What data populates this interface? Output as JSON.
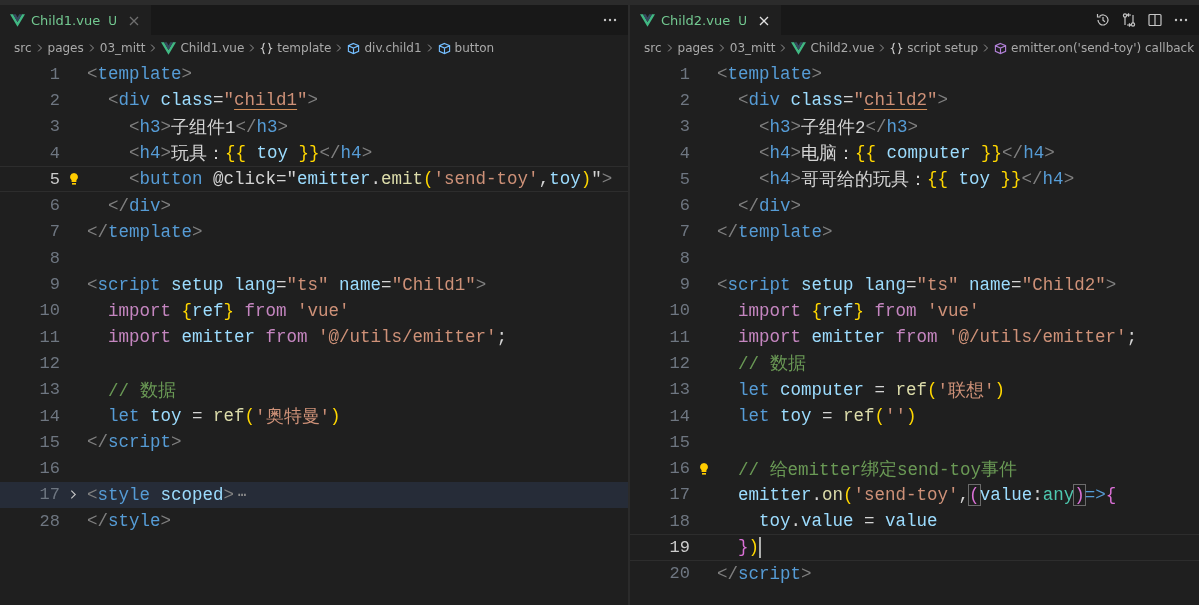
{
  "editors": [
    {
      "tab": {
        "label": "Child1.vue",
        "status": "U",
        "selected": true
      },
      "actions": [
        {
          "kind": "more"
        }
      ],
      "breadcrumbs": [
        {
          "label": "src",
          "kind": "folder"
        },
        {
          "label": "pages",
          "kind": "folder"
        },
        {
          "label": "03_mitt",
          "kind": "folder"
        },
        {
          "label": "Child1.vue",
          "kind": "vue"
        },
        {
          "label": "template",
          "kind": "braces"
        },
        {
          "label": "div.child1",
          "kind": "element"
        },
        {
          "label": "button",
          "kind": "element"
        }
      ],
      "lines": [
        {
          "number": "1",
          "tokens": [
            {
              "text": "<",
              "kind": "p"
            },
            {
              "text": "template",
              "kind": "tag"
            },
            {
              "text": ">",
              "kind": "p"
            }
          ]
        },
        {
          "number": "2",
          "tokens": [
            {
              "text": "  <",
              "kind": "p"
            },
            {
              "text": "div",
              "kind": "tag"
            },
            {
              "text": " class",
              "kind": "attr"
            },
            {
              "text": "=",
              "kind": "text"
            },
            {
              "text": "\"",
              "kind": "string"
            },
            {
              "text": "child1",
              "kind": "classname"
            },
            {
              "text": "\"",
              "kind": "string"
            },
            {
              "text": ">",
              "kind": "p"
            }
          ]
        },
        {
          "number": "3",
          "tokens": [
            {
              "text": "    <",
              "kind": "p"
            },
            {
              "text": "h3",
              "kind": "tag"
            },
            {
              "text": ">",
              "kind": "p"
            },
            {
              "text": "子组件1",
              "kind": "text"
            },
            {
              "text": "</",
              "kind": "p"
            },
            {
              "text": "h3",
              "kind": "tag"
            },
            {
              "text": ">",
              "kind": "p"
            }
          ]
        },
        {
          "number": "4",
          "tokens": [
            {
              "text": "    <",
              "kind": "p"
            },
            {
              "text": "h4",
              "kind": "tag"
            },
            {
              "text": ">",
              "kind": "p"
            },
            {
              "text": "玩具：",
              "kind": "text"
            },
            {
              "text": "{{",
              "kind": "brace"
            },
            {
              "text": " toy ",
              "kind": "var"
            },
            {
              "text": "}}",
              "kind": "brace"
            },
            {
              "text": "</",
              "kind": "p"
            },
            {
              "text": "h4",
              "kind": "tag"
            },
            {
              "text": ">",
              "kind": "p"
            }
          ]
        },
        {
          "number": "5",
          "current": true,
          "bulb": true,
          "tokens": [
            {
              "text": "    <",
              "kind": "p"
            },
            {
              "text": "button",
              "kind": "tag"
            },
            {
              "text": " @click=\"",
              "kind": "text"
            },
            {
              "text": "emitter",
              "kind": "var"
            },
            {
              "text": ".",
              "kind": "text"
            },
            {
              "text": "emit",
              "kind": "func"
            },
            {
              "text": "(",
              "kind": "brace"
            },
            {
              "text": "'send-toy'",
              "kind": "string"
            },
            {
              "text": ",",
              "kind": "text"
            },
            {
              "text": "toy",
              "kind": "var"
            },
            {
              "text": ")",
              "kind": "brace"
            },
            {
              "text": "\"",
              "kind": "text"
            },
            {
              "text": ">",
              "kind": "p"
            }
          ]
        },
        {
          "number": "6",
          "tokens": [
            {
              "text": "  </",
              "kind": "p"
            },
            {
              "text": "div",
              "kind": "tag"
            },
            {
              "text": ">",
              "kind": "p"
            }
          ]
        },
        {
          "number": "7",
          "tokens": [
            {
              "text": "</",
              "kind": "p"
            },
            {
              "text": "template",
              "kind": "tag"
            },
            {
              "text": ">",
              "kind": "p"
            }
          ]
        },
        {
          "number": "8"
        },
        {
          "number": "9",
          "tokens": [
            {
              "text": "<",
              "kind": "p"
            },
            {
              "text": "script",
              "kind": "tag"
            },
            {
              "text": " setup lang",
              "kind": "attr"
            },
            {
              "text": "=",
              "kind": "text"
            },
            {
              "text": "\"ts\"",
              "kind": "string"
            },
            {
              "text": " name",
              "kind": "attr"
            },
            {
              "text": "=",
              "kind": "text"
            },
            {
              "text": "\"Child1\"",
              "kind": "string"
            },
            {
              "text": ">",
              "kind": "p"
            }
          ]
        },
        {
          "number": "10",
          "tokens": [
            {
              "text": "  import",
              "kind": "keyword"
            },
            {
              "text": " {",
              "kind": "brace"
            },
            {
              "text": "ref",
              "kind": "var"
            },
            {
              "text": "}",
              "kind": "brace"
            },
            {
              "text": " from",
              "kind": "keyword"
            },
            {
              "text": " 'vue'",
              "kind": "string"
            }
          ]
        },
        {
          "number": "11",
          "tokens": [
            {
              "text": "  import",
              "kind": "keyword"
            },
            {
              "text": " emitter",
              "kind": "var"
            },
            {
              "text": " from",
              "kind": "keyword"
            },
            {
              "text": " '@/utils/emitter'",
              "kind": "string"
            },
            {
              "text": ";",
              "kind": "text"
            }
          ]
        },
        {
          "number": "12"
        },
        {
          "number": "13",
          "tokens": [
            {
              "text": "  // 数据",
              "kind": "comment"
            }
          ]
        },
        {
          "number": "14",
          "tokens": [
            {
              "text": "  let",
              "kind": "tag"
            },
            {
              "text": " toy",
              "kind": "var"
            },
            {
              "text": " = ",
              "kind": "text"
            },
            {
              "text": "ref",
              "kind": "func"
            },
            {
              "text": "(",
              "kind": "brace"
            },
            {
              "text": "'奥特曼'",
              "kind": "string"
            },
            {
              "text": ")",
              "kind": "brace"
            }
          ]
        },
        {
          "number": "15",
          "tokens": [
            {
              "text": "</",
              "kind": "p"
            },
            {
              "text": "script",
              "kind": "tag"
            },
            {
              "text": ">",
              "kind": "p"
            }
          ]
        },
        {
          "number": "16"
        },
        {
          "number": "17",
          "folded": true,
          "tokens": [
            {
              "text": "<",
              "kind": "p"
            },
            {
              "text": "style",
              "kind": "tag"
            },
            {
              "text": " scoped",
              "kind": "attr"
            },
            {
              "text": ">",
              "kind": "p"
            },
            {
              "text": "⋯",
              "kind": "ellipsis"
            }
          ]
        },
        {
          "number": "28",
          "tokens": [
            {
              "text": "</",
              "kind": "p"
            },
            {
              "text": "style",
              "kind": "tag"
            },
            {
              "text": ">",
              "kind": "p"
            }
          ]
        }
      ]
    },
    {
      "tab": {
        "label": "Child2.vue",
        "status": "U",
        "selected": true
      },
      "actions": [
        {
          "kind": "history"
        },
        {
          "kind": "compare"
        },
        {
          "kind": "split"
        },
        {
          "kind": "more"
        }
      ],
      "breadcrumbs": [
        {
          "label": "src",
          "kind": "folder"
        },
        {
          "label": "pages",
          "kind": "folder"
        },
        {
          "label": "03_mitt",
          "kind": "folder"
        },
        {
          "label": "Child2.vue",
          "kind": "vue"
        },
        {
          "label": "script setup",
          "kind": "braces"
        },
        {
          "label": "emitter.on('send-toy') callback",
          "kind": "method"
        }
      ],
      "lines": [
        {
          "number": "1",
          "tokens": [
            {
              "text": "<",
              "kind": "p"
            },
            {
              "text": "template",
              "kind": "tag"
            },
            {
              "text": ">",
              "kind": "p"
            }
          ]
        },
        {
          "number": "2",
          "tokens": [
            {
              "text": "  <",
              "kind": "p"
            },
            {
              "text": "div",
              "kind": "tag"
            },
            {
              "text": " class",
              "kind": "attr"
            },
            {
              "text": "=",
              "kind": "text"
            },
            {
              "text": "\"",
              "kind": "string"
            },
            {
              "text": "child2",
              "kind": "classname"
            },
            {
              "text": "\"",
              "kind": "string"
            },
            {
              "text": ">",
              "kind": "p"
            }
          ]
        },
        {
          "number": "3",
          "tokens": [
            {
              "text": "    <",
              "kind": "p"
            },
            {
              "text": "h3",
              "kind": "tag"
            },
            {
              "text": ">",
              "kind": "p"
            },
            {
              "text": "子组件2",
              "kind": "text"
            },
            {
              "text": "</",
              "kind": "p"
            },
            {
              "text": "h3",
              "kind": "tag"
            },
            {
              "text": ">",
              "kind": "p"
            }
          ]
        },
        {
          "number": "4",
          "tokens": [
            {
              "text": "    <",
              "kind": "p"
            },
            {
              "text": "h4",
              "kind": "tag"
            },
            {
              "text": ">",
              "kind": "p"
            },
            {
              "text": "电脑：",
              "kind": "text"
            },
            {
              "text": "{{",
              "kind": "brace"
            },
            {
              "text": " computer ",
              "kind": "var"
            },
            {
              "text": "}}",
              "kind": "brace"
            },
            {
              "text": "</",
              "kind": "p"
            },
            {
              "text": "h4",
              "kind": "tag"
            },
            {
              "text": ">",
              "kind": "p"
            }
          ]
        },
        {
          "number": "5",
          "tokens": [
            {
              "text": "    <",
              "kind": "p"
            },
            {
              "text": "h4",
              "kind": "tag"
            },
            {
              "text": ">",
              "kind": "p"
            },
            {
              "text": "哥哥给的玩具：",
              "kind": "text"
            },
            {
              "text": "{{",
              "kind": "brace"
            },
            {
              "text": " toy ",
              "kind": "var"
            },
            {
              "text": "}}",
              "kind": "brace"
            },
            {
              "text": "</",
              "kind": "p"
            },
            {
              "text": "h4",
              "kind": "tag"
            },
            {
              "text": ">",
              "kind": "p"
            }
          ]
        },
        {
          "number": "6",
          "tokens": [
            {
              "text": "  </",
              "kind": "p"
            },
            {
              "text": "div",
              "kind": "tag"
            },
            {
              "text": ">",
              "kind": "p"
            }
          ]
        },
        {
          "number": "7",
          "tokens": [
            {
              "text": "</",
              "kind": "p"
            },
            {
              "text": "template",
              "kind": "tag"
            },
            {
              "text": ">",
              "kind": "p"
            }
          ]
        },
        {
          "number": "8"
        },
        {
          "number": "9",
          "tokens": [
            {
              "text": "<",
              "kind": "p"
            },
            {
              "text": "script",
              "kind": "tag"
            },
            {
              "text": " setup lang",
              "kind": "attr"
            },
            {
              "text": "=",
              "kind": "text"
            },
            {
              "text": "\"ts\"",
              "kind": "string"
            },
            {
              "text": " name",
              "kind": "attr"
            },
            {
              "text": "=",
              "kind": "text"
            },
            {
              "text": "\"Child2\"",
              "kind": "string"
            },
            {
              "text": ">",
              "kind": "p"
            }
          ]
        },
        {
          "number": "10",
          "tokens": [
            {
              "text": "  import",
              "kind": "keyword"
            },
            {
              "text": " {",
              "kind": "brace"
            },
            {
              "text": "ref",
              "kind": "var"
            },
            {
              "text": "}",
              "kind": "brace"
            },
            {
              "text": " from",
              "kind": "keyword"
            },
            {
              "text": " 'vue'",
              "kind": "string"
            }
          ]
        },
        {
          "number": "11",
          "tokens": [
            {
              "text": "  import",
              "kind": "keyword"
            },
            {
              "text": " emitter",
              "kind": "var"
            },
            {
              "text": " from",
              "kind": "keyword"
            },
            {
              "text": " '@/utils/emitter'",
              "kind": "string"
            },
            {
              "text": ";",
              "kind": "text"
            }
          ]
        },
        {
          "number": "12",
          "tokens": [
            {
              "text": "  // 数据",
              "kind": "comment"
            }
          ]
        },
        {
          "number": "13",
          "tokens": [
            {
              "text": "  let",
              "kind": "tag"
            },
            {
              "text": " computer",
              "kind": "var"
            },
            {
              "text": " = ",
              "kind": "text"
            },
            {
              "text": "ref",
              "kind": "func"
            },
            {
              "text": "(",
              "kind": "brace"
            },
            {
              "text": "'联想'",
              "kind": "string"
            },
            {
              "text": ")",
              "kind": "brace"
            }
          ]
        },
        {
          "number": "14",
          "tokens": [
            {
              "text": "  let",
              "kind": "tag"
            },
            {
              "text": " toy",
              "kind": "var"
            },
            {
              "text": " = ",
              "kind": "text"
            },
            {
              "text": "ref",
              "kind": "func"
            },
            {
              "text": "(",
              "kind": "brace"
            },
            {
              "text": "''",
              "kind": "string"
            },
            {
              "text": ")",
              "kind": "brace"
            }
          ]
        },
        {
          "number": "15"
        },
        {
          "number": "16",
          "bulb": true,
          "tokens": [
            {
              "text": "  // 给emitter绑定send-toy事件",
              "kind": "comment"
            }
          ]
        },
        {
          "number": "17",
          "tokens": [
            {
              "text": "  emitter",
              "kind": "var"
            },
            {
              "text": ".",
              "kind": "text"
            },
            {
              "text": "on",
              "kind": "func"
            },
            {
              "text": "(",
              "kind": "brace"
            },
            {
              "text": "'send-toy'",
              "kind": "string"
            },
            {
              "text": ",",
              "kind": "text"
            },
            {
              "text": "(",
              "kind": "match"
            },
            {
              "text": "value",
              "kind": "var"
            },
            {
              "text": ":",
              "kind": "text"
            },
            {
              "text": "any",
              "kind": "type"
            },
            {
              "text": ")",
              "kind": "match"
            },
            {
              "text": "=>",
              "kind": "tag"
            },
            {
              "text": "{",
              "kind": "brace2"
            }
          ]
        },
        {
          "number": "18",
          "tokens": [
            {
              "text": "    toy",
              "kind": "var"
            },
            {
              "text": ".",
              "kind": "text"
            },
            {
              "text": "value",
              "kind": "var"
            },
            {
              "text": " = ",
              "kind": "text"
            },
            {
              "text": "value",
              "kind": "var"
            }
          ]
        },
        {
          "number": "19",
          "current": true,
          "cursor": true,
          "tokens": [
            {
              "text": "  }",
              "kind": "brace2"
            },
            {
              "text": ")",
              "kind": "brace"
            }
          ]
        },
        {
          "number": "20",
          "tokens": [
            {
              "text": "</",
              "kind": "p"
            },
            {
              "text": "script",
              "kind": "tag"
            },
            {
              "text": ">",
              "kind": "p"
            }
          ]
        }
      ]
    }
  ]
}
